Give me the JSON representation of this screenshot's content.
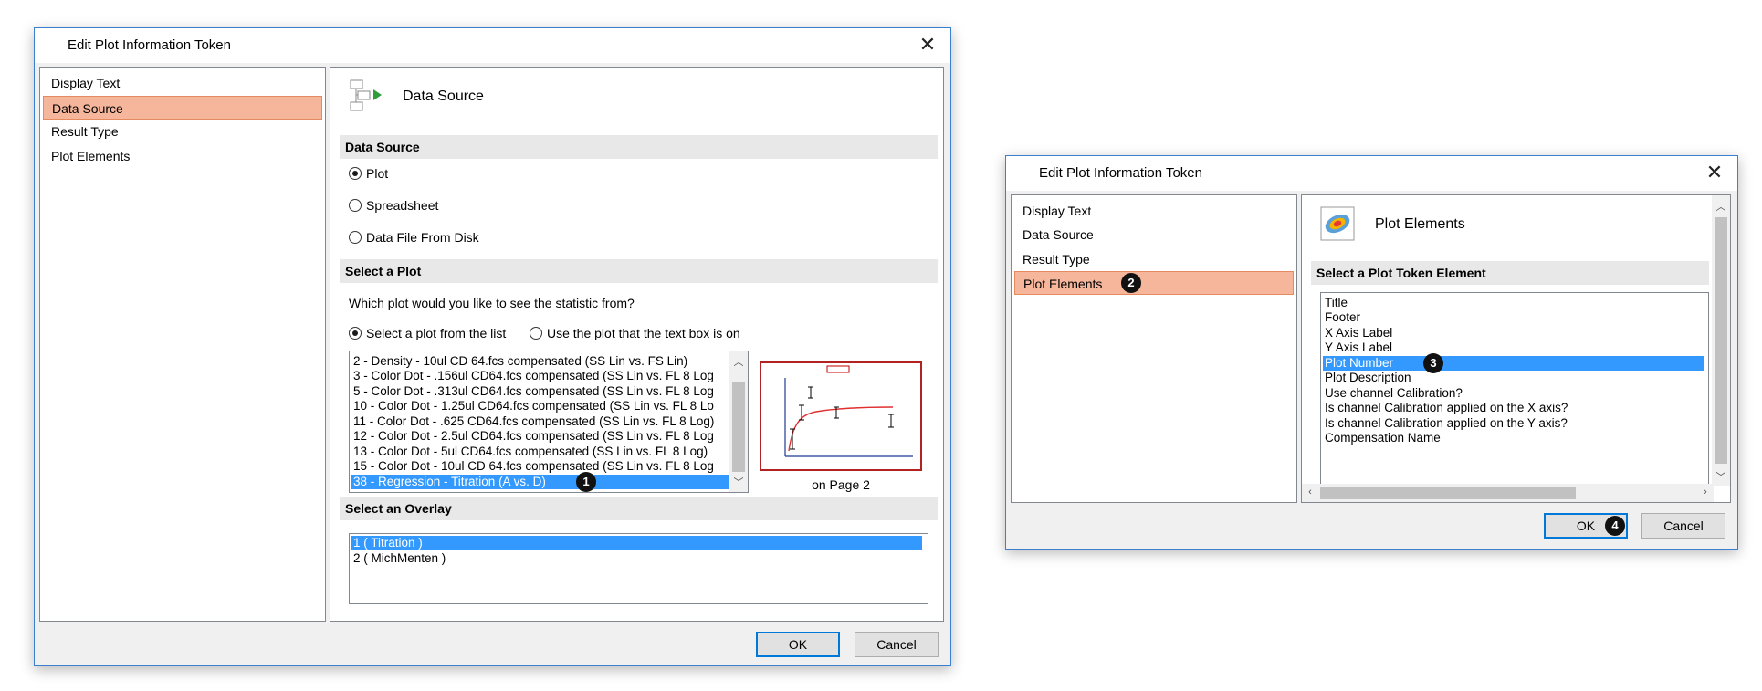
{
  "dialog1": {
    "title": "Edit Plot Information Token",
    "nav": [
      "Display Text",
      "Data Source",
      "Result Type",
      "Plot Elements"
    ],
    "header_title": "Data Source",
    "section_data_source": "Data Source",
    "radio_plot": "Plot",
    "radio_spreadsheet": "Spreadsheet",
    "radio_file": "Data File From Disk",
    "section_select_plot": "Select a Plot",
    "question": "Which plot would you like to see the statistic from?",
    "radio_select_list": "Select a plot from the list",
    "radio_use_textbox": "Use the plot that the text box is on",
    "plots": [
      "2 - Density - 10ul CD 64.fcs compensated (SS Lin vs. FS Lin)",
      "3 - Color Dot - .156ul CD64.fcs compensated (SS Lin vs. FL 8 Log",
      "5 - Color Dot - .313ul CD64.fcs compensated (SS Lin vs. FL 8 Log",
      "10 - Color Dot - 1.25ul CD64.fcs compensated (SS Lin vs. FL 8 Lo",
      "11 - Color Dot - .625 CD64.fcs compensated (SS Lin vs. FL 8 Log)",
      "12 - Color Dot - 2.5ul CD64.fcs compensated (SS Lin vs. FL 8 Log",
      "13 - Color Dot - 5ul CD64.fcs compensated (SS Lin vs. FL 8 Log)",
      "15 - Color Dot - 10ul CD 64.fcs compensated (SS Lin vs. FL 8 Log",
      "38 - Regression - Titration (A vs. D)"
    ],
    "badge1": "1",
    "preview_caption": "on Page 2",
    "section_overlay": "Select an Overlay",
    "overlays": [
      "1 ( Titration )",
      "2 ( MichMenten )"
    ],
    "ok": "OK",
    "cancel": "Cancel"
  },
  "dialog2": {
    "title": "Edit Plot Information Token",
    "nav": [
      "Display Text",
      "Data Source",
      "Result Type",
      "Plot Elements"
    ],
    "badge2": "2",
    "header_title": "Plot Elements",
    "section_token": "Select a Plot Token Element",
    "elements": [
      "Title",
      "Footer",
      "X Axis Label",
      "Y Axis Label",
      "Plot Number",
      "Plot Description",
      "Use channel Calibration?",
      "Is channel Calibration applied on the X axis?",
      "Is channel Calibration applied on the Y axis?",
      "Compensation Name"
    ],
    "badge3": "3",
    "ok": "OK",
    "badge4": "4",
    "cancel": "Cancel"
  },
  "colors": {
    "selection": "#3399ff",
    "nav_selected": "#f6b69b",
    "accent_border": "#0078d7"
  },
  "icons": [
    "close-icon",
    "data-source-icon",
    "plot-elements-icon",
    "chevron-up-icon",
    "chevron-down-icon"
  ]
}
